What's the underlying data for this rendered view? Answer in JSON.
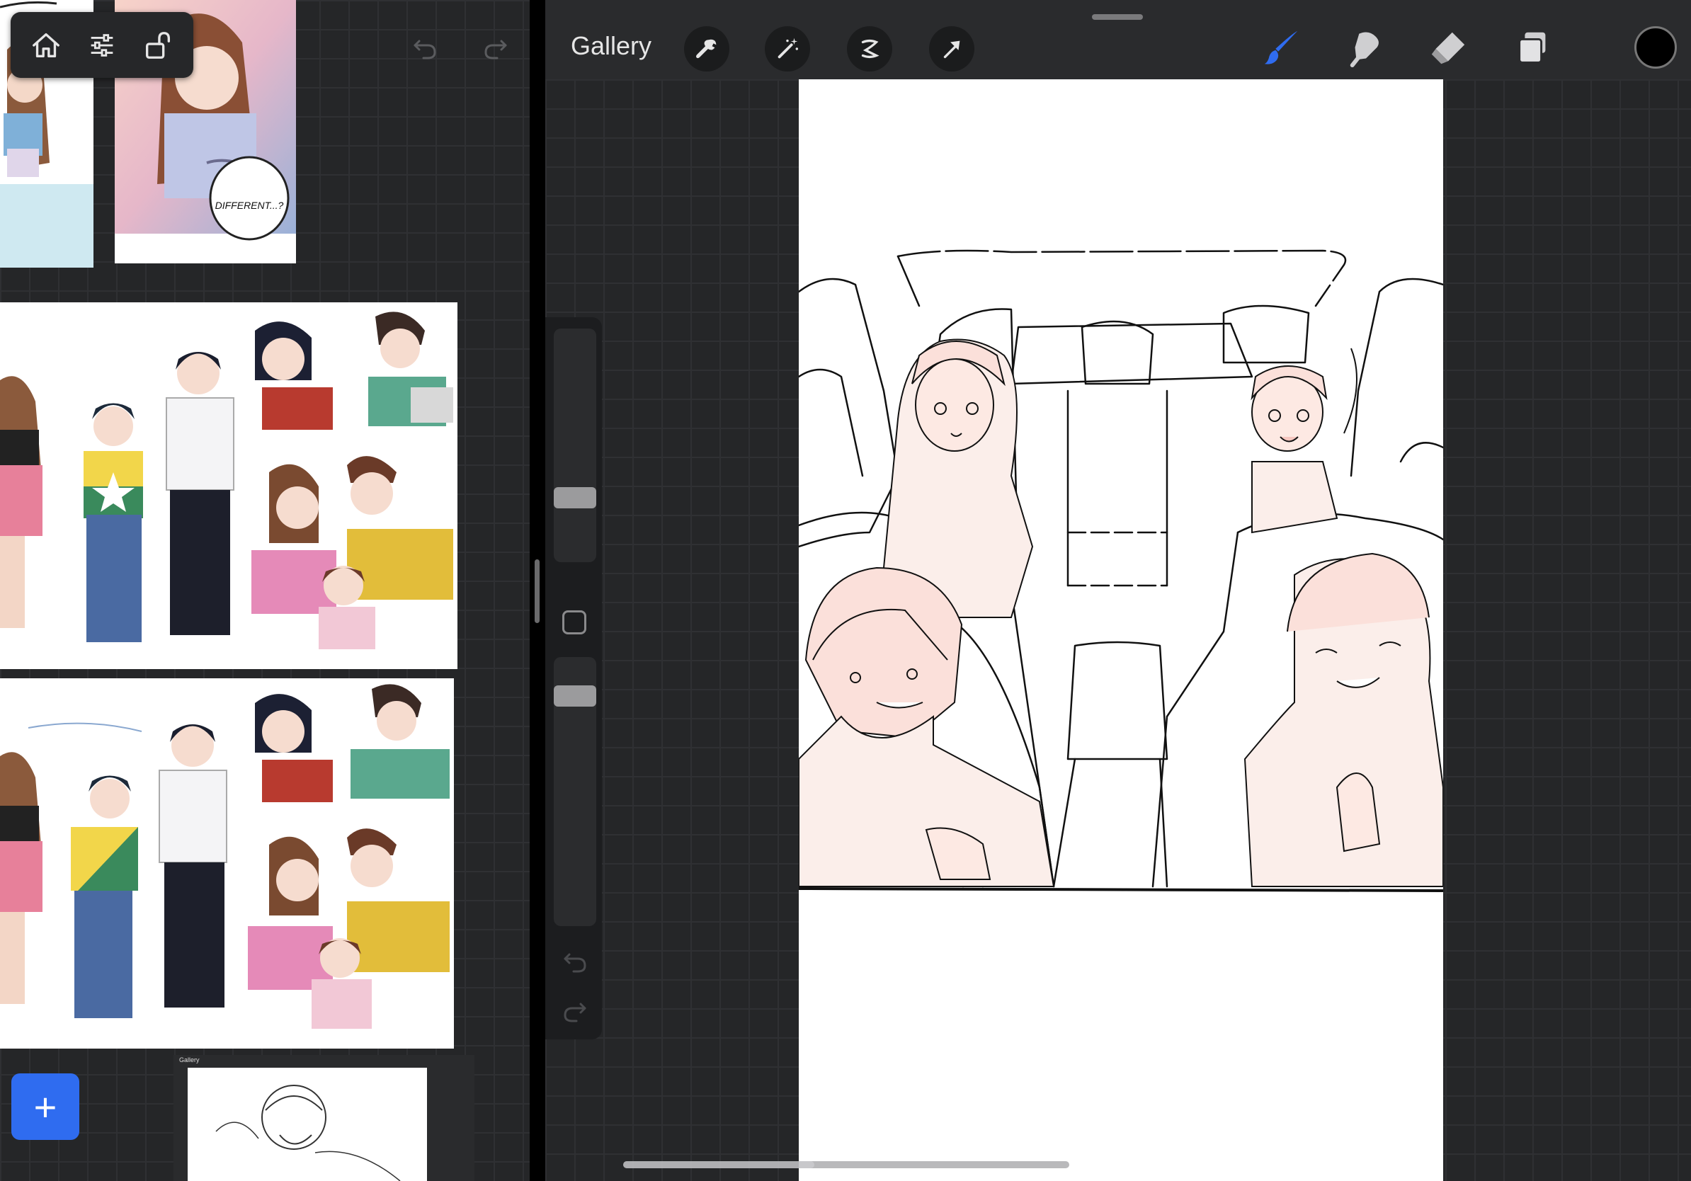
{
  "left": {
    "toolbar": {
      "home_icon": "home-icon",
      "adjust_icon": "sliders-icon",
      "lock_icon": "unlock-icon"
    },
    "undo_icon": "undo-icon",
    "redo_icon": "redo-icon",
    "speech_text": "DIFFERENT...?",
    "add_label": "+"
  },
  "right": {
    "gallery_label": "Gallery",
    "tools": [
      "wrench-icon",
      "magic-wand-icon",
      "selection-icon",
      "transform-arrow-icon"
    ],
    "draw_tools": [
      "brush-icon",
      "smudge-icon",
      "eraser-icon",
      "layers-icon"
    ],
    "color": "#000000",
    "brush_active_color": "#2f6cf0"
  },
  "mini_preview": {
    "gallery_label": "Gallery"
  }
}
